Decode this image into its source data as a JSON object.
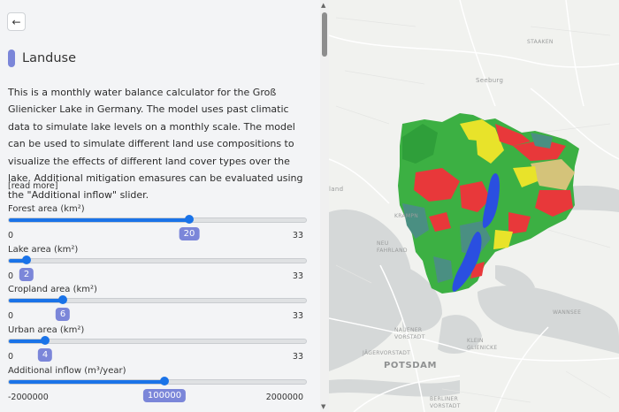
{
  "panel": {
    "back_icon": "arrow-left-icon",
    "title": "Landuse",
    "description": "This is a monthly water balance calculator for the Groß Glienicker Lake in Germany. The model uses past climatic data to simulate lake levels on a monthly scale. The model can be used to simulate different land use compositions to visualize the effects of different land cover types over the lake. Additional mitigation emasures can be evaluated using the \"Additional inflow\" slider.",
    "read_more": "[read more]",
    "sliders": [
      {
        "label": "Forest area (km²)",
        "min": "0",
        "max": "33",
        "value": "20",
        "fraction": 0.606
      },
      {
        "label": "Lake area (km²)",
        "min": "0",
        "max": "33",
        "value": "2",
        "fraction": 0.061
      },
      {
        "label": "Cropland area (km²)",
        "min": "0",
        "max": "33",
        "value": "6",
        "fraction": 0.182
      },
      {
        "label": "Urban area (km²)",
        "min": "0",
        "max": "33",
        "value": "4",
        "fraction": 0.121
      },
      {
        "label": "Additional inflow (m³/year)",
        "min": "-2000000",
        "max": "2000000",
        "value": "100000",
        "fraction": 0.525
      }
    ]
  },
  "map": {
    "labels": {
      "staaken": "STAAKEN",
      "seeburg": "Seeburg",
      "land": "land",
      "kramp": "KRAMPN",
      "neu_fahrland": "NEU\nFAHRLAND",
      "nauener": "NAUENER\nVORSTADT",
      "wannsee": "WANNSEE",
      "klein_glienicke": "KLEIN\nGLIENICKE",
      "jaegervorstadt": "JÄGERVORSTADT",
      "potsdam": "POTSDAM",
      "berliner": "BERLINER\nVORSTADT"
    },
    "colors": {
      "forest": "#3cb043",
      "water": "#2a4fe0",
      "crop": "#e8e32a",
      "urban": "#e8383a",
      "grass": "#4a8f82"
    }
  }
}
